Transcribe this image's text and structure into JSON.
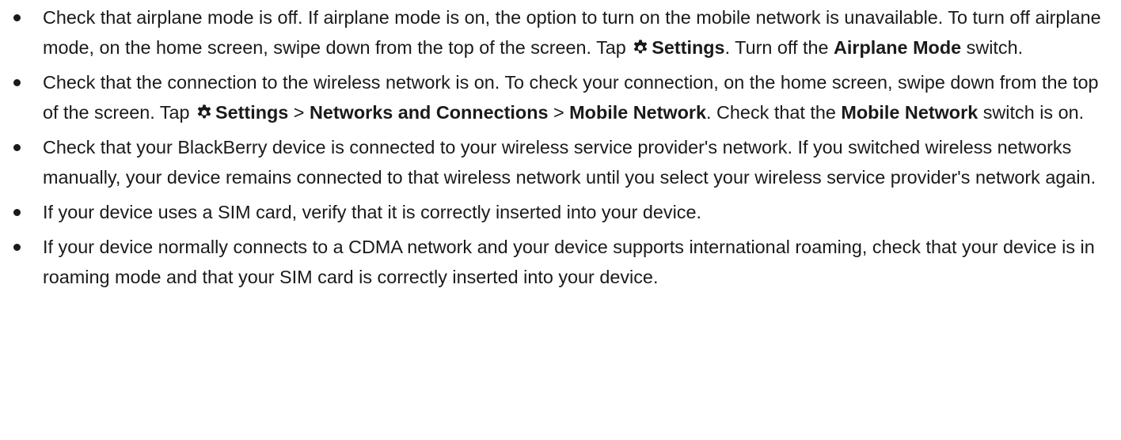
{
  "items": [
    {
      "parts": [
        "Check that airplane mode is off. If airplane mode is on, the option to turn on the mobile network is unavailable. To turn off airplane mode, on the home screen, swipe down from the top of the screen. Tap ",
        "Settings",
        ". Turn off the ",
        "Airplane Mode",
        " switch."
      ]
    },
    {
      "parts": [
        "Check that the connection to the wireless network is on. To check your connection, on the home screen, swipe down from the top of the screen. Tap ",
        "Settings",
        " > ",
        "Networks and Connections",
        " > ",
        "Mobile Network",
        ". Check that the ",
        "Mobile Network",
        " switch is on."
      ]
    },
    {
      "text": "Check that your BlackBerry device is connected to your wireless service provider's network. If you switched wireless networks manually, your device remains connected to that wireless network until you select your wireless service provider's network again."
    },
    {
      "text": "If your device uses a SIM card, verify that it is correctly inserted into your device."
    },
    {
      "text": "If your device normally connects to a CDMA network and your device supports international roaming, check that your device is in roaming mode and that your SIM card is correctly inserted into your device."
    }
  ],
  "icons": {
    "settings": "gear-icon"
  },
  "colors": {
    "text": "#1a1a1a",
    "background": "#ffffff"
  }
}
